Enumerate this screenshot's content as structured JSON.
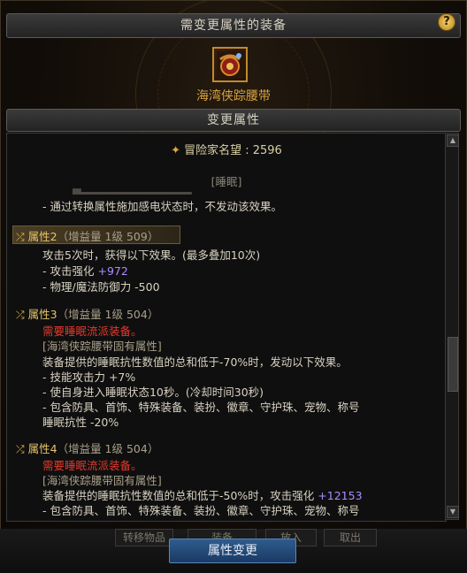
{
  "header": {
    "title": "需变更属性的装备",
    "help_label": "?"
  },
  "item": {
    "name": "海湾侠踪腰带",
    "icon": "belt-icon"
  },
  "section": {
    "title": "变更属性"
  },
  "fame": {
    "text": "冒险家名望 : 2596"
  },
  "partial_top": {
    "bracket_text": "[睡眠]",
    "cut_line": "- 通过转换属性施加感电状态时，不发动该效果。"
  },
  "attr2": {
    "head": "属性2",
    "sub": "（增益量 1级 509）",
    "lines": [
      "攻击5次时，获得以下效果。(最多叠加10次)",
      "- 攻击强化",
      "- 物理/魔法防御力 -500"
    ],
    "bonus": "+972"
  },
  "attr3": {
    "head": "属性3",
    "sub": "（增益量 1级 504）",
    "requirement": "需要睡眠流派装备。",
    "tag": "[海湾侠踪腰带固有属性]",
    "lines": [
      "装备提供的睡眠抗性数值的总和低于-70%时，发动以下效果。",
      "- 技能攻击力 +7%",
      "- 使自身进入睡眠状态10秒。(冷却时间30秒)",
      "- 包含防具、首饰、特殊装备、装扮、徽章、守护珠、宠物、称号",
      "睡眠抗性 -20%"
    ]
  },
  "attr4": {
    "head": "属性4",
    "sub": "（增益量 1级 504）",
    "requirement": "需要睡眠流派装备。",
    "tag": "[海湾侠踪腰带固有属性]",
    "lines": [
      "装备提供的睡眠抗性数值的总和低于-50%时，攻击强化",
      "- 包含防具、首饰、特殊装备、装扮、徽章、守护珠、宠物、称号"
    ],
    "bonus": "+12153"
  },
  "footer": {
    "ghost_buttons": [
      "转移物品",
      "装备",
      "放入",
      "取出"
    ],
    "main_button": "属性变更"
  }
}
